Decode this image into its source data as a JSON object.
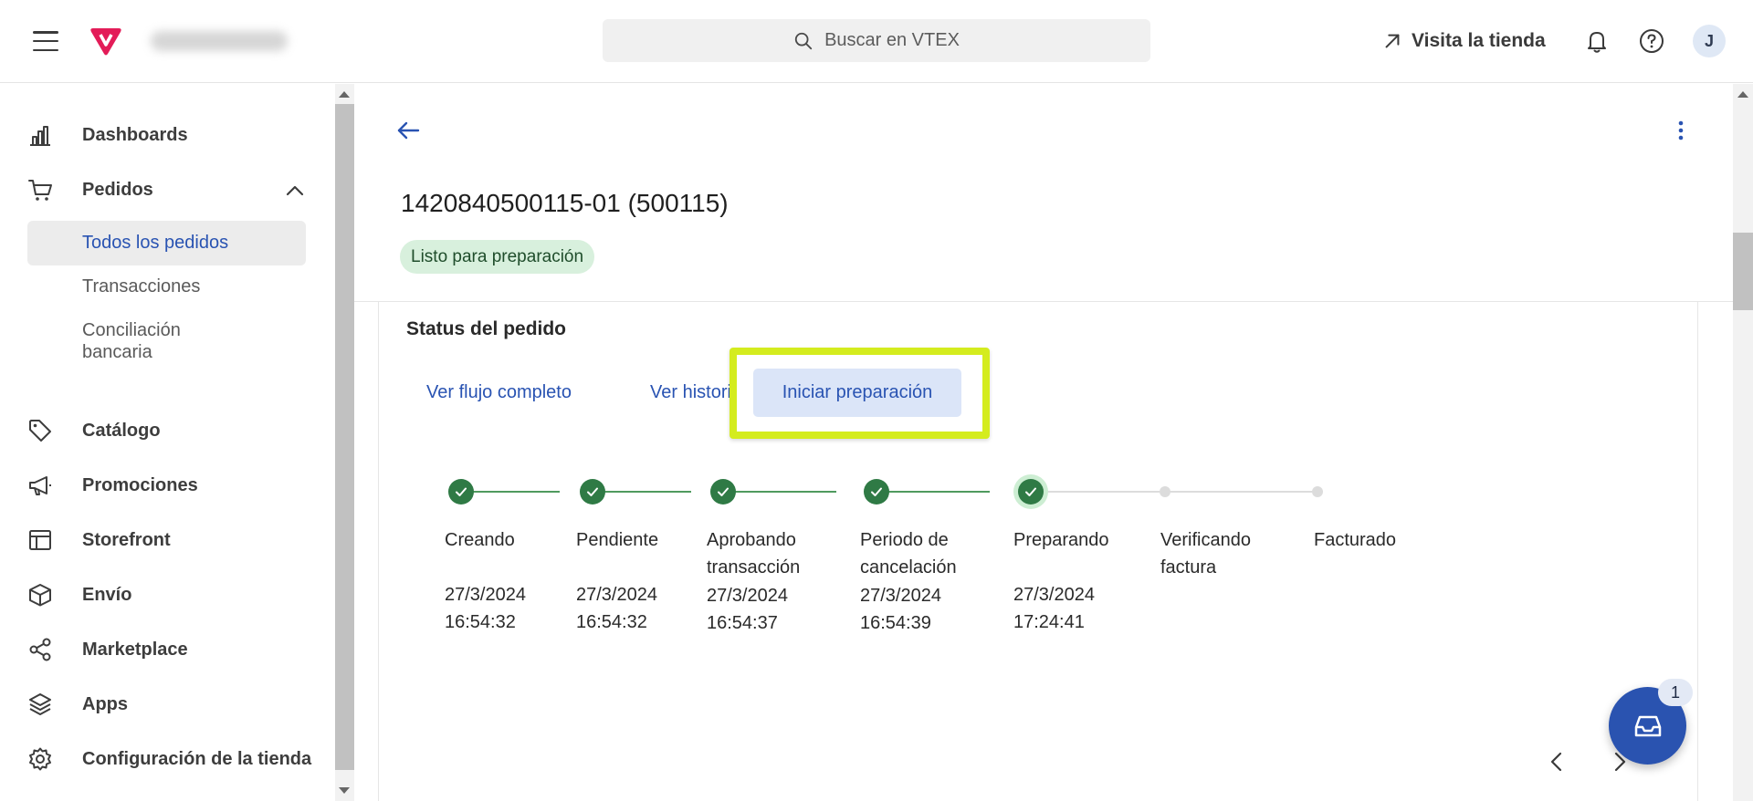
{
  "topbar": {
    "search_placeholder": "Buscar en VTEX",
    "visit_store": "Visita la tienda",
    "avatar_initial": "J",
    "logo_color": "#e31c58"
  },
  "sidebar": {
    "items": [
      {
        "label": "Dashboards",
        "icon": "bar-chart-icon"
      },
      {
        "label": "Pedidos",
        "icon": "cart-icon"
      },
      {
        "label": "Catálogo",
        "icon": "tag-icon"
      },
      {
        "label": "Promociones",
        "icon": "megaphone-icon"
      },
      {
        "label": "Storefront",
        "icon": "layout-icon"
      },
      {
        "label": "Envío",
        "icon": "box-icon"
      },
      {
        "label": "Marketplace",
        "icon": "share-icon"
      },
      {
        "label": "Apps",
        "icon": "layers-icon"
      },
      {
        "label": "Configuración de la tienda",
        "icon": "gear-icon"
      }
    ],
    "sub_items": [
      {
        "label": "Todos los pedidos",
        "active": true
      },
      {
        "label": "Transacciones",
        "active": false
      },
      {
        "label": "Conciliación bancaria",
        "line1": "Conciliación",
        "line2": "bancaria",
        "active": false
      }
    ]
  },
  "order": {
    "title": "1420840500115-01 (500115)",
    "status": "Listo para preparación"
  },
  "status_card": {
    "title": "Status del pedido",
    "link_full_flow": "Ver flujo completo",
    "link_history": "Ver historia",
    "primary_action": "Iniciar preparación",
    "steps": [
      {
        "line1": "Creando",
        "line2": "",
        "date": "27/3/2024",
        "time": "16:54:32",
        "state": "done"
      },
      {
        "line1": "Pendiente",
        "line2": "",
        "date": "27/3/2024",
        "time": "16:54:32",
        "state": "done"
      },
      {
        "line1": "Aprobando",
        "line2": "transacción",
        "date": "27/3/2024",
        "time": "16:54:37",
        "state": "done"
      },
      {
        "line1": "Periodo de",
        "line2": "cancelación",
        "date": "27/3/2024",
        "time": "16:54:39",
        "state": "done"
      },
      {
        "line1": "Preparando",
        "line2": "",
        "date": "27/3/2024",
        "time": "17:24:41",
        "state": "current"
      },
      {
        "line1": "Verificando",
        "line2": "factura",
        "date": "",
        "time": "",
        "state": "pending"
      },
      {
        "line1": "Facturado",
        "line2": "",
        "date": "",
        "time": "",
        "state": "pending"
      }
    ]
  },
  "fab": {
    "badge_count": "1",
    "color": "#2a53b0"
  },
  "colors": {
    "accent": "#2953b2",
    "success": "#2f7a45",
    "highlight": "#d4ec1e"
  }
}
